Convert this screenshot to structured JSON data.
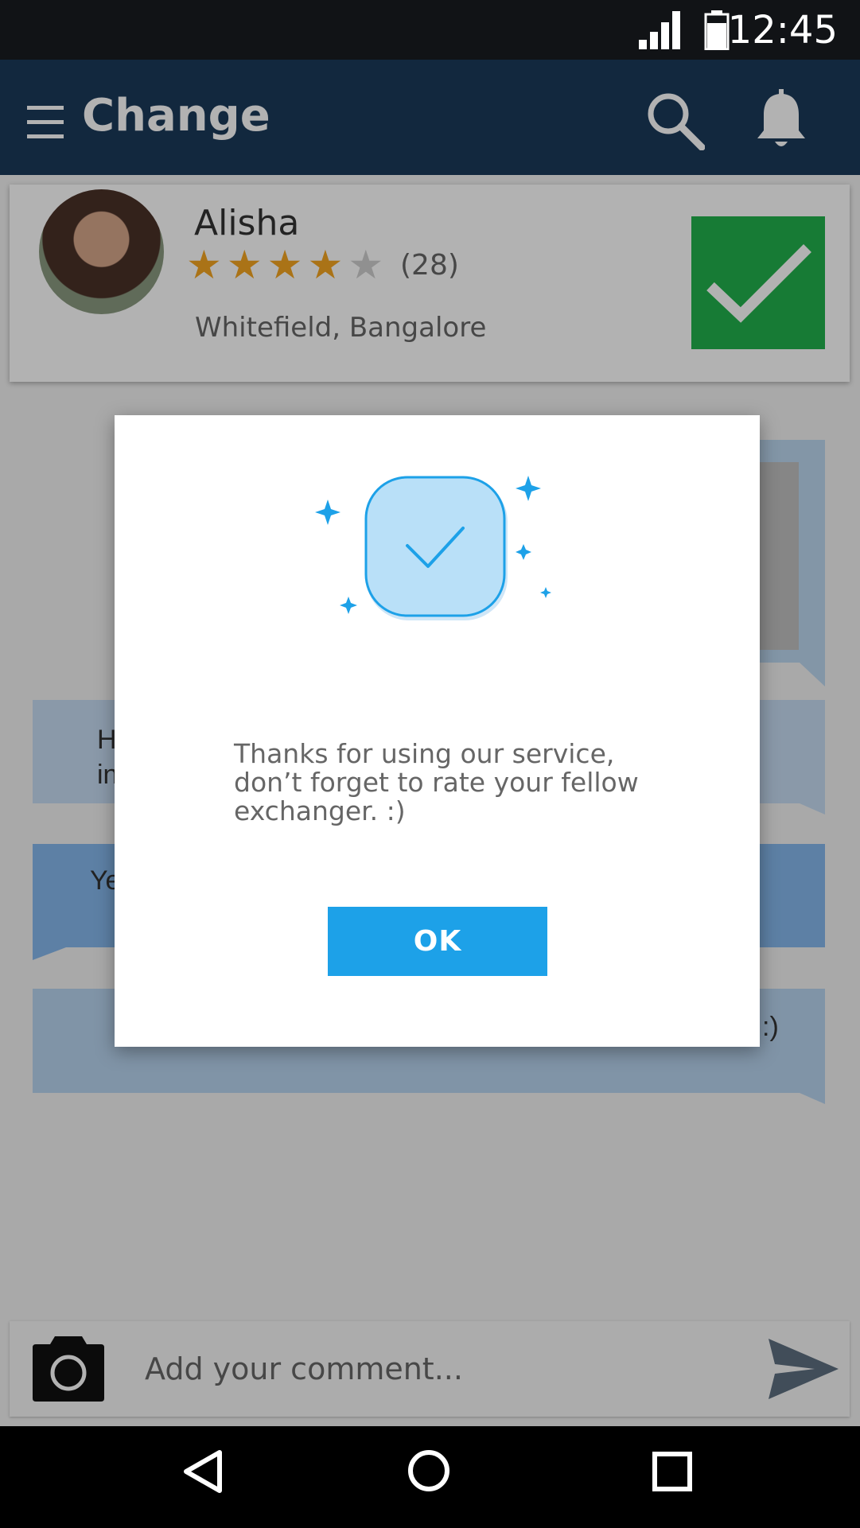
{
  "status_bar": {
    "time": "12:45",
    "signal_icon": "signal-icon",
    "battery_icon": "battery-icon"
  },
  "toolbar": {
    "title": "Change",
    "menu_icon": "menu-icon",
    "search_icon": "search-icon",
    "notification_icon": "bell-icon"
  },
  "profile": {
    "name": "Alisha",
    "rating": 4,
    "rating_max": 5,
    "rating_count": "(28)",
    "location": "Whitefield, Bangalore",
    "confirm_icon": "checkmark-icon"
  },
  "chat": {
    "messages": [
      {
        "visible_text": ""
      },
      {
        "visible_text": "H\nin"
      },
      {
        "visible_text": "Ye"
      },
      {
        "visible_text": ":)"
      }
    ]
  },
  "comment_bar": {
    "placeholder": "Add your comment...",
    "camera_icon": "camera-icon",
    "send_icon": "send-icon"
  },
  "dialog": {
    "message": "Thanks for using our service, don’t forget to rate your fellow exchanger. :)",
    "ok_label": "OK",
    "illustration": "success-checkmark-icon"
  },
  "nav_bar": {
    "back_icon": "back-icon",
    "home_icon": "home-icon",
    "recent_icon": "recent-apps-icon"
  },
  "colors": {
    "toolbar": "#1a3a5a",
    "confirm": "#22b14c",
    "accent": "#1da1e8",
    "star": "#f4a522"
  }
}
